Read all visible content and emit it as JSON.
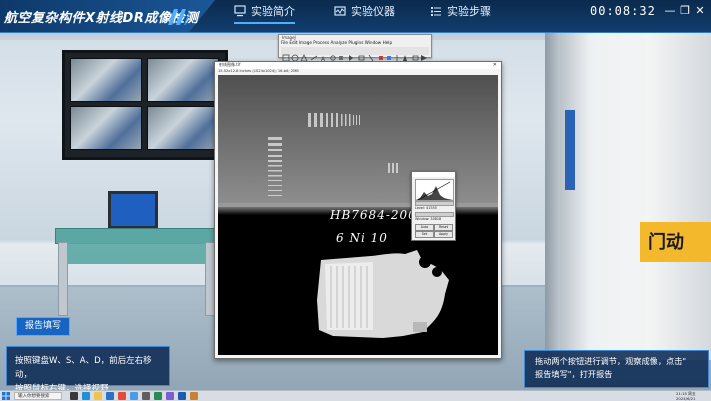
{
  "header": {
    "app_title": "航空复杂构件X射线DR成像检测",
    "tabs": [
      {
        "label": "实验简介",
        "icon": "monitor-icon",
        "active": true
      },
      {
        "label": "实验仪器",
        "icon": "instrument-icon",
        "active": false
      },
      {
        "label": "实验步骤",
        "icon": "list-icon",
        "active": false
      }
    ],
    "timer": "00:08:32"
  },
  "imagej": {
    "toolbar_title": "ImageJ",
    "menu": [
      "File",
      "Edit",
      "Image",
      "Process",
      "Analyze",
      "Plugins",
      "Window",
      "Help"
    ],
    "image_window_title": "射线图像.tif",
    "image_info": "15.52x12.8 inches (1024x1024); 16-bit; 2MB",
    "handwriting_line1": "HB7684-2000",
    "handwriting_line2": "6  Ni  10"
  },
  "wl_dialog": {
    "level_label": "Level:",
    "level_value": "41555",
    "window_label": "Window:",
    "window_value": "30818",
    "buttons": [
      "Auto",
      "Reset",
      "Set",
      "Apply"
    ]
  },
  "door_sign": "门动",
  "report_button": "报告填写",
  "hint_left": {
    "line1": "按照键盘W、S、A、D，前后左右移动，",
    "line2": "按照鼠标右键，选择视野"
  },
  "hint_right": {
    "line1": "拖动两个按钮进行调节，观察成像，点击\"",
    "line2": "报告填写\"，打开报告"
  },
  "taskbar": {
    "search_placeholder": "输入你想要搜索",
    "time": "21:15 周五",
    "date": "2024/6/21"
  },
  "colors": {
    "topbar": "#0b2a4d",
    "accent": "#1765c2",
    "panel": "#0c2a53"
  }
}
